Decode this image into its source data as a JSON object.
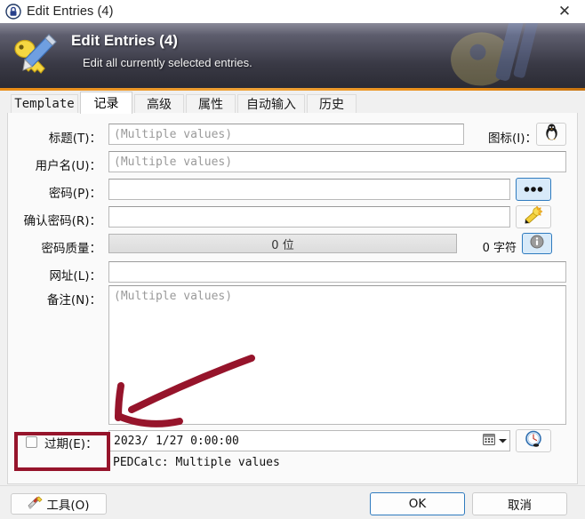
{
  "window": {
    "title": "Edit Entries (4)",
    "close_label": "✕",
    "icon": "lock-icon"
  },
  "banner": {
    "title": "Edit Entries (4)",
    "subtitle": "Edit all currently selected entries.",
    "icon": "key-pencil-icon",
    "accent_color": "#e98c16"
  },
  "tabs": [
    {
      "label": "Template",
      "active": false,
      "mono": true
    },
    {
      "label": "记录",
      "active": true,
      "mono": false
    },
    {
      "label": "高级",
      "active": false,
      "mono": false
    },
    {
      "label": "属性",
      "active": false,
      "mono": false
    },
    {
      "label": "自动输入",
      "active": false,
      "mono": false
    },
    {
      "label": "历史",
      "active": false,
      "mono": false
    }
  ],
  "form": {
    "title": {
      "label": "标题(T)：",
      "value": "",
      "placeholder": "(Multiple values)"
    },
    "icon_picker": {
      "label": "图标(I)：",
      "icon": "penguin-icon"
    },
    "username": {
      "label": "用户名(U)：",
      "value": "",
      "placeholder": "(Multiple values)"
    },
    "password": {
      "label": "密码(P)：",
      "value": "",
      "placeholder": "",
      "reveal_icon": "three-dots-icon"
    },
    "repeat_password": {
      "label": "确认密码(R)：",
      "value": "",
      "placeholder": "",
      "generate_icon": "key-generator-icon"
    },
    "quality": {
      "label": "密码质量：",
      "bits_text": "0 位",
      "chars_text": "0 字符",
      "percent": 0,
      "info_icon": "info-icon"
    },
    "url": {
      "label": "网址(L)：",
      "value": "",
      "placeholder": ""
    },
    "notes": {
      "label": "备注(N)：",
      "value": "",
      "placeholder": "(Multiple values)"
    },
    "expiry": {
      "label": "过期(E)：",
      "checked": false,
      "date_value": "2023/ 1/27  0:00:00",
      "calendar_icon": "calendar-icon",
      "dropdown_icon": "chevron-down-icon",
      "clock_icon": "clock-icon",
      "pedcalc_text": "PEDCalc: Multiple values"
    }
  },
  "footer": {
    "tools_label": "工具(O)",
    "tools_icon": "tools-icon",
    "ok_label": "OK",
    "cancel_label": "取消"
  },
  "annotations": {
    "highlight_color": "#96142b",
    "arrow": "hand-drawn-arrow",
    "rect": "highlight-rectangle"
  }
}
